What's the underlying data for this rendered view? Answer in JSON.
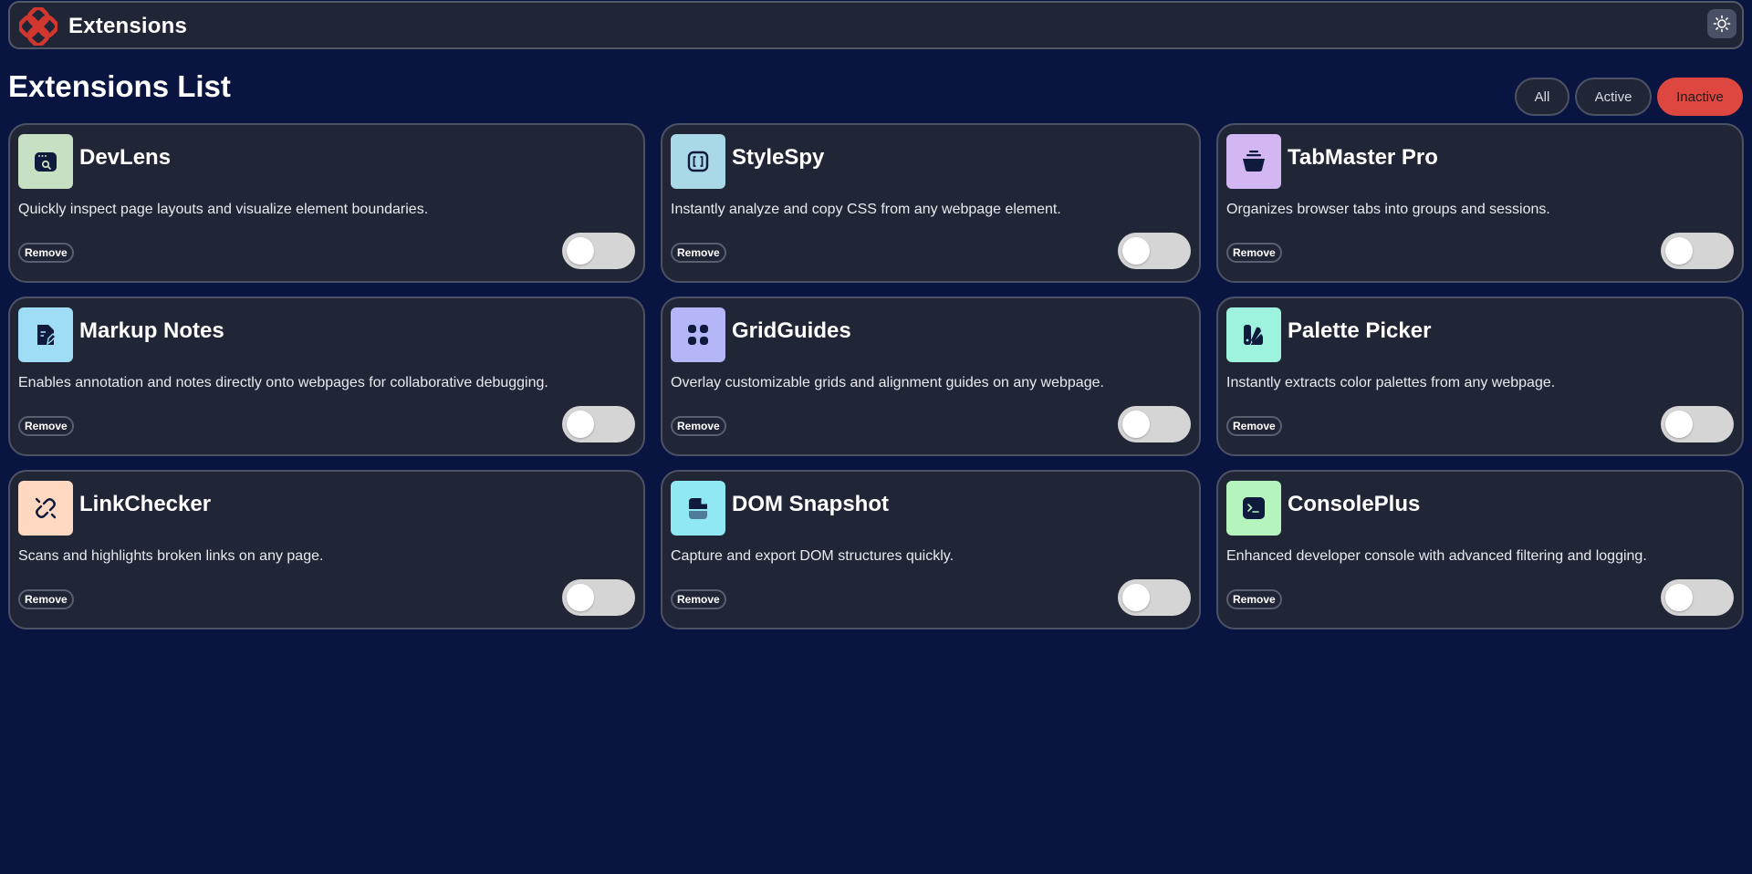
{
  "header": {
    "title": "Extensions",
    "logo_icon": "extensions-logo-icon",
    "theme_icon": "sun-icon",
    "brand_color": "#d1372e"
  },
  "main": {
    "title": "Extensions List",
    "filters": [
      {
        "label": "All",
        "selected": false
      },
      {
        "label": "Active",
        "selected": false
      },
      {
        "label": "Inactive",
        "selected": true
      }
    ],
    "accent_color": "#de473f"
  },
  "extensions": [
    {
      "name": "DevLens",
      "description": "Quickly inspect page layouts and visualize element boundaries.",
      "icon": "devlens-icon",
      "icon_bg": "#c7dfc2",
      "remove_label": "Remove",
      "enabled": false
    },
    {
      "name": "StyleSpy",
      "description": "Instantly analyze and copy CSS from any webpage element.",
      "icon": "stylespy-icon",
      "icon_bg": "#a9d8e6",
      "remove_label": "Remove",
      "enabled": false
    },
    {
      "name": "TabMaster Pro",
      "description": "Organizes browser tabs into groups and sessions.",
      "icon": "tabmaster-icon",
      "icon_bg": "#d2b7f2",
      "remove_label": "Remove",
      "enabled": false
    },
    {
      "name": "Markup Notes",
      "description": "Enables annotation and notes directly onto webpages for collaborative debugging.",
      "icon": "markup-notes-icon",
      "icon_bg": "#9fdcf6",
      "remove_label": "Remove",
      "enabled": false
    },
    {
      "name": "GridGuides",
      "description": "Overlay customizable grids and alignment guides on any webpage.",
      "icon": "gridguides-icon",
      "icon_bg": "#b4b6f8",
      "remove_label": "Remove",
      "enabled": false
    },
    {
      "name": "Palette Picker",
      "description": "Instantly extracts color palettes from any webpage.",
      "icon": "palette-picker-icon",
      "icon_bg": "#9ef3de",
      "remove_label": "Remove",
      "enabled": false
    },
    {
      "name": "LinkChecker",
      "description": "Scans and highlights broken links on any page.",
      "icon": "linkchecker-icon",
      "icon_bg": "#ffd8c2",
      "remove_label": "Remove",
      "enabled": false
    },
    {
      "name": "DOM Snapshot",
      "description": "Capture and export DOM structures quickly.",
      "icon": "dom-snapshot-icon",
      "icon_bg": "#8fe8f2",
      "remove_label": "Remove",
      "enabled": false
    },
    {
      "name": "ConsolePlus",
      "description": "Enhanced developer console with advanced filtering and logging.",
      "icon": "consoleplus-icon",
      "icon_bg": "#b5f5bd",
      "remove_label": "Remove",
      "enabled": false
    }
  ]
}
